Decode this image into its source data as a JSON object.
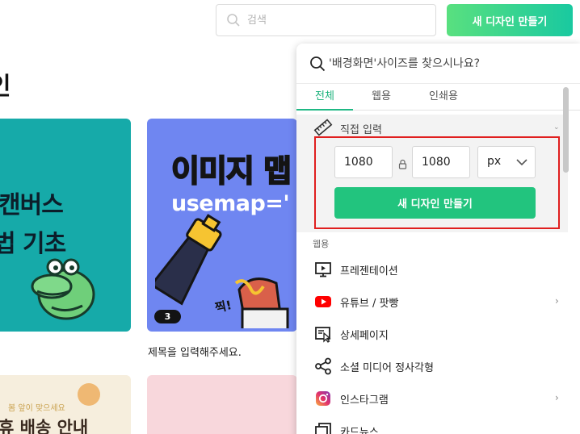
{
  "header": {
    "search_placeholder": "검색",
    "new_design_button": "새 디자인 만들기",
    "page_title": "인"
  },
  "cards": [
    {
      "line1": "캔버스",
      "line2": "법 기초"
    },
    {
      "title": "이미지 맵",
      "subtitle": "usemap='",
      "badge": "3",
      "sticker": "찍!",
      "caption": "제목을 입력해주세요."
    },
    {
      "sub": "봄 앞이 맞으세요",
      "main": "휴 배송 안내"
    },
    {}
  ],
  "panel": {
    "search_placeholder": "'배경화면'사이즈를 찾으시나요?",
    "tabs": [
      {
        "label": "전체",
        "active": true
      },
      {
        "label": "웹용",
        "active": false
      },
      {
        "label": "인쇄용",
        "active": false
      }
    ],
    "direct_input": {
      "title": "직접 입력",
      "width": "1080",
      "height": "1080",
      "unit": "px",
      "create_button": "새 디자인 만들기"
    },
    "section_label": "웹용",
    "items": [
      {
        "label": "프레젠테이션",
        "icon": "presentation-icon",
        "has_arrow": false
      },
      {
        "label": "유튜브 / 팟빵",
        "icon": "youtube-icon",
        "has_arrow": true
      },
      {
        "label": "상세페이지",
        "icon": "detail-page-icon",
        "has_arrow": false
      },
      {
        "label": "소셜 미디어 정사각형",
        "icon": "share-icon",
        "has_arrow": false
      },
      {
        "label": "인스타그램",
        "icon": "instagram-icon",
        "has_arrow": true
      },
      {
        "label": "카드뉴스",
        "icon": "card-news-icon",
        "has_arrow": false
      }
    ]
  },
  "colors": {
    "accent_green": "#22c47e",
    "highlight_red": "#e01f1f",
    "youtube_red": "#ff0000"
  }
}
